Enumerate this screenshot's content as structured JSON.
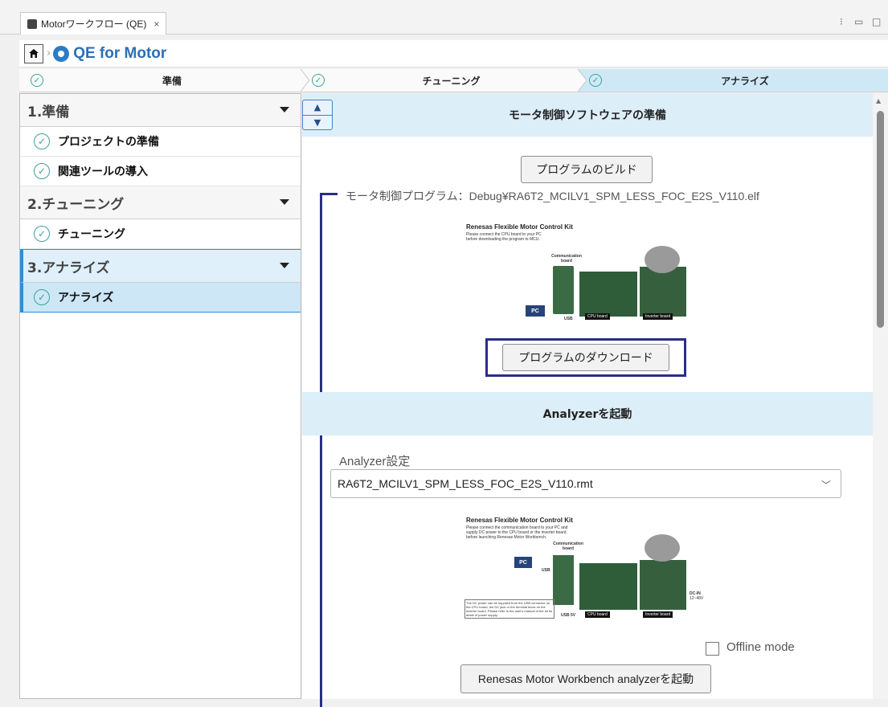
{
  "tab": {
    "title": "Motorワークフロー (QE)",
    "close": "×"
  },
  "breadcrumb": {
    "product": "QE for Motor"
  },
  "steps": [
    {
      "label": "準備"
    },
    {
      "label": "チューニング"
    },
    {
      "label": "アナライズ"
    }
  ],
  "sidebar": {
    "sections": [
      {
        "title": "1.準備",
        "items": [
          "プロジェクトの準備",
          "関連ツールの導入"
        ]
      },
      {
        "title": "2.チューニング",
        "items": [
          "チューニング"
        ]
      },
      {
        "title": "3.アナライズ",
        "items": [
          "アナライズ"
        ]
      }
    ]
  },
  "main": {
    "section1_title": "モータ制御ソフトウェアの準備",
    "build_button": "プログラムのビルド",
    "program_path": "モータ制御プログラム：Debug¥RA6T2_MCILV1_SPM_LESS_FOC_E2S_V110.elf",
    "kit1": {
      "title": "Renesas Flexible Motor Control Kit",
      "sub1": "Please connect the CPU board to your PC",
      "sub2": "before downloading the program to MCU.",
      "comm": "Communication board",
      "pc": "PC",
      "usb": "USB",
      "cpu": "CPU board",
      "inv": "Inverter board"
    },
    "download_button": "プログラムのダウンロード",
    "section2_title": "Analyzerを起動",
    "analyzer_label": "Analyzer設定",
    "analyzer_value": "RA6T2_MCILV1_SPM_LESS_FOC_E2S_V110.rmt",
    "kit2": {
      "title": "Renesas Flexible Motor Control Kit",
      "sub1": "Please connect the communication board to your PC and",
      "sub2": "supply DC power to the CPU board or the inverter board",
      "sub3": "before launching Renesas Motor Workbench.",
      "comm": "Communication board",
      "pc": "PC",
      "usb": "USB",
      "usb5v": "USB 5V",
      "cpu": "CPU board",
      "inv": "Inverter board",
      "dcin": "DC-IN",
      "dcv": "12~48V",
      "note": "The DC power can be supplied from the USB connector on the CPU board, the DC jack or the terminal block on the inverter board. Please refer to the user's manual of the kit for detail of power supply."
    },
    "offline_label": "Offline mode",
    "launch_button": "Renesas Motor Workbench analyzerを起動"
  },
  "colors": {
    "accent": "#2f8fd6",
    "check": "#3aa39a",
    "highlight": "#2b2d8a",
    "band": "#dceef8"
  }
}
